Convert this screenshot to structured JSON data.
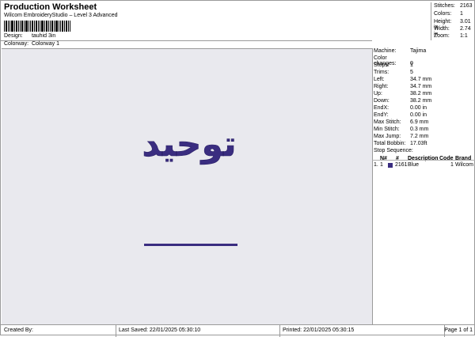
{
  "header": {
    "title": "Production Worksheet",
    "subtitle": "Wilcom EmbroideryStudio – Level 3 Advanced",
    "design_label": "Design:",
    "design_value": "tauhid 3in",
    "colorway_label": "Colorway:",
    "colorway_value": "Colorway 1"
  },
  "stats": [
    {
      "label": "Stitches:",
      "value": "2163"
    },
    {
      "label": "Colors:",
      "value": "1"
    },
    {
      "label": "Height:",
      "value": "3.01 in"
    },
    {
      "label": "Width:",
      "value": "2.74 in"
    },
    {
      "label": "Zoom:",
      "value": "1:1"
    }
  ],
  "details": [
    {
      "label": "Machine:",
      "value": "Tajima"
    },
    {
      "label": "Color changes:",
      "value": "0"
    },
    {
      "label": "Stops:",
      "value": "1"
    },
    {
      "label": "Trims:",
      "value": "5"
    },
    {
      "label": "Left:",
      "value": "34.7 mm"
    },
    {
      "label": "Right:",
      "value": "34.7 mm"
    },
    {
      "label": "Up:",
      "value": "38.2 mm"
    },
    {
      "label": "Down:",
      "value": "38.2 mm"
    },
    {
      "label": "EndX:",
      "value": "0.00 in"
    },
    {
      "label": "EndY:",
      "value": "0.00 in"
    },
    {
      "label": "Max Stitch:",
      "value": "6.9 mm"
    },
    {
      "label": "Min Stitch:",
      "value": "0.3 mm"
    },
    {
      "label": "Max Jump:",
      "value": "7.2 mm"
    },
    {
      "label": "Total Bobbin:",
      "value": "17.03ft"
    }
  ],
  "sequence": {
    "heading": "Stop Sequence:",
    "columns": {
      "n": "N#",
      "stitches": "#",
      "description": "Description",
      "code": "Code",
      "brand": "Brand"
    },
    "rows": [
      {
        "index": "1.",
        "n": "1",
        "color": "#3a2d80",
        "stitches": "2161",
        "description": "Blue",
        "code": "1",
        "brand": "Wilcom"
      }
    ]
  },
  "design_text": "توحيد",
  "colors": {
    "thread": "#3a2d80",
    "canvas": "#e9e9ee"
  },
  "footer": {
    "created": "Created By:",
    "saved": "Last Saved: 22/01/2025 05:30:10",
    "printed": "Printed: 22/01/2025 05:30:15",
    "page": "Page 1 of 1"
  }
}
